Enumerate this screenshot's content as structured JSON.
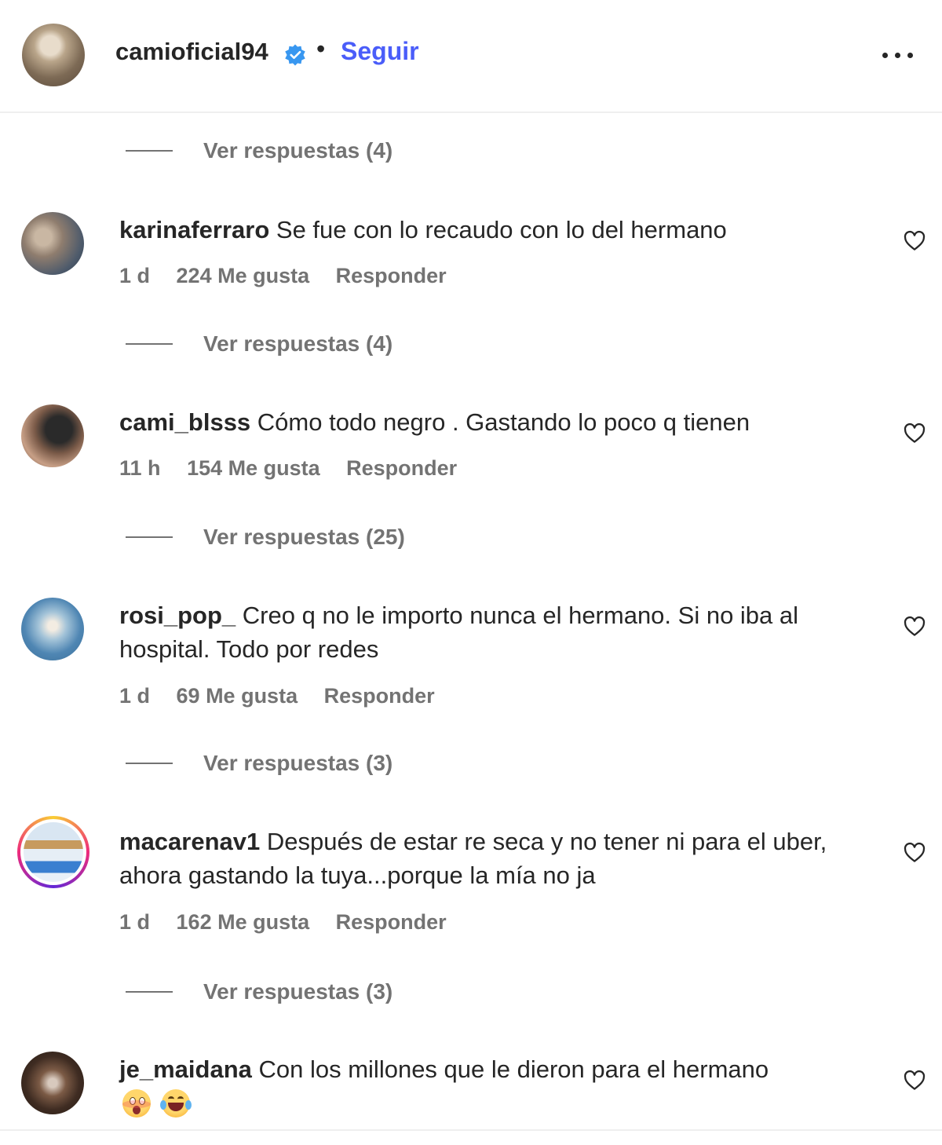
{
  "header": {
    "username": "camioficial94",
    "separator": "•",
    "follow_label": "Seguir",
    "icons": {
      "verified": "verified-badge-icon",
      "more": "more-options-icon"
    },
    "colors": {
      "follow": "#4a5df9",
      "verified": "#3897f0"
    }
  },
  "replies": [
    {
      "label": "Ver respuestas (4)"
    },
    {
      "label": "Ver respuestas (4)"
    },
    {
      "label": "Ver respuestas (25)"
    },
    {
      "label": "Ver respuestas (3)"
    },
    {
      "label": "Ver respuestas (3)"
    }
  ],
  "comments": [
    {
      "username": "karinaferraro",
      "text": "Se fue con lo recaudo con lo del hermano",
      "time": "1 d",
      "likes": "224 Me gusta",
      "reply_label": "Responder"
    },
    {
      "username": "cami_blsss",
      "text": "Cómo todo negro . Gastando lo poco q tienen",
      "time": "11 h",
      "likes": "154 Me gusta",
      "reply_label": "Responder"
    },
    {
      "username": "rosi_pop_",
      "text": "Creo q no le importo nunca el hermano. Si no iba al hospital. Todo por redes",
      "time": "1 d",
      "likes": "69 Me gusta",
      "reply_label": "Responder"
    },
    {
      "username": "macarenav1",
      "text": "Después de estar re seca y no tener ni para el uber, ahora gastando la tuya...porque la mía no ja",
      "time": "1 d",
      "likes": "162 Me gusta",
      "reply_label": "Responder"
    },
    {
      "username": "je_maidana",
      "text": "Con los millones que le dieron para el hermano",
      "emojis": [
        "surprised-face-emoji",
        "laughing-tears-emoji"
      ]
    }
  ],
  "icons": {
    "like": "heart-icon"
  }
}
